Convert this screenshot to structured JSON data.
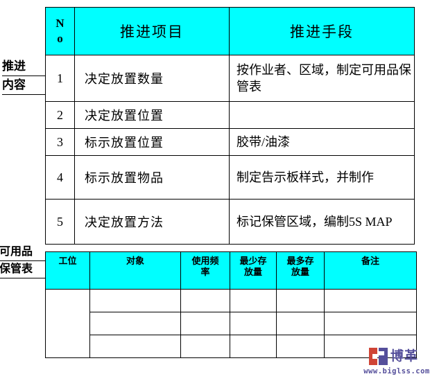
{
  "side_labels": {
    "promotion_content": {
      "line1": "推进",
      "line2": "内容"
    },
    "usable_item_table": {
      "line1": "可用品",
      "line2": "保管表"
    }
  },
  "promotion_table": {
    "headers": {
      "no_line1": "N",
      "no_line2": "o",
      "item": "推进项目",
      "means": "推进手段"
    },
    "rows": [
      {
        "no": "1",
        "item": "决定放置数量",
        "means": "按作业者、区域，制定可用品保管表"
      },
      {
        "no": "2",
        "item": "决定放置位置",
        "means": ""
      },
      {
        "no": "3",
        "item": "标示放置位置",
        "means": "胶带/油漆"
      },
      {
        "no": "4",
        "item": "标示放置物品",
        "means": "制定告示板样式，并制作"
      },
      {
        "no": "5",
        "item": "决定放置方法",
        "means": "标记保管区域，编制5S MAP"
      }
    ]
  },
  "storage_table": {
    "headers": [
      {
        "line1": "工位",
        "line2": ""
      },
      {
        "line1": "对象",
        "line2": ""
      },
      {
        "line1": "使用频",
        "line2": "率"
      },
      {
        "line1": "最少存",
        "line2": "放量"
      },
      {
        "line1": "最多存",
        "line2": "放量"
      },
      {
        "line1": "备注",
        "line2": ""
      }
    ],
    "body_rows": [
      {
        "station": "",
        "object": "",
        "frequency": "",
        "min_qty": "",
        "max_qty": "",
        "remark": ""
      },
      {
        "station": "",
        "object": "",
        "frequency": "",
        "min_qty": "",
        "max_qty": "",
        "remark": ""
      },
      {
        "station": "",
        "object": "",
        "frequency": "",
        "min_qty": "",
        "max_qty": "",
        "remark": ""
      }
    ]
  },
  "brand": {
    "name": "博革",
    "url": "www.biglss.com"
  },
  "colors": {
    "header_fill": "#00FFFF",
    "border": "#000000",
    "brand_red": "#CF4436",
    "brand_purple": "#554F9B"
  }
}
